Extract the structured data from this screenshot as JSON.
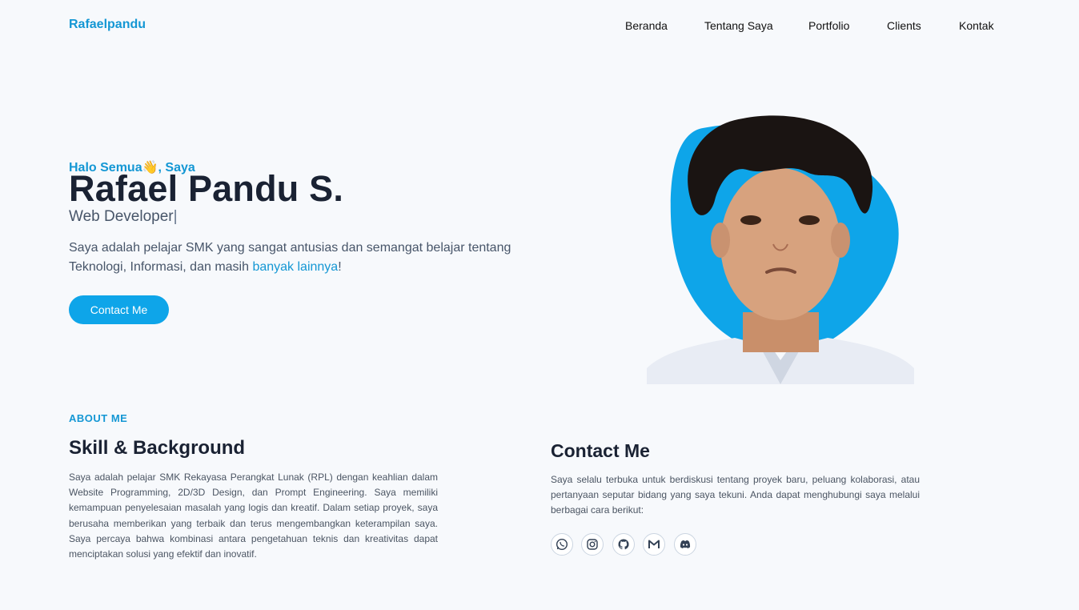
{
  "header": {
    "brand": "Rafaelpandu",
    "nav": [
      "Beranda",
      "Tentang Saya",
      "Portfolio",
      "Clients",
      "Kontak"
    ]
  },
  "hero": {
    "greeting": "Halo Semua👋, Saya",
    "name": "Rafael Pandu S.",
    "role": "Web Developer",
    "role_caret": "|",
    "intro_main": "Saya adalah pelajar SMK yang sangat antusias dan semangat belajar tentang Teknologi, Informasi, dan masih ",
    "intro_highlight": "banyak lainnya",
    "intro_end": "!",
    "cta_label": "Contact Me",
    "accent_color": "#0ea5e9"
  },
  "about": {
    "kicker": "ABOUT ME",
    "title": "Skill & Background",
    "text": "Saya adalah pelajar SMK Rekayasa Perangkat Lunak (RPL) dengan keahlian dalam Website Programming, 2D/3D Design, dan Prompt Engineering. Saya memiliki kemampuan penyelesaian masalah yang logis dan kreatif. Dalam setiap proyek, saya berusaha memberikan yang terbaik dan terus mengembangkan keterampilan saya. Saya percaya bahwa kombinasi antara pengetahuan teknis dan kreativitas dapat menciptakan solusi yang efektif dan inovatif."
  },
  "contact": {
    "title": "Contact Me",
    "text": "Saya selalu terbuka untuk berdiskusi tentang proyek baru, peluang kolaborasi, atau pertanyaan seputar bidang yang saya tekuni. Anda dapat menghubungi saya melalui berbagai cara berikut:",
    "socials": [
      "whatsapp-icon",
      "instagram-icon",
      "github-icon",
      "gmail-icon",
      "discord-icon"
    ]
  }
}
